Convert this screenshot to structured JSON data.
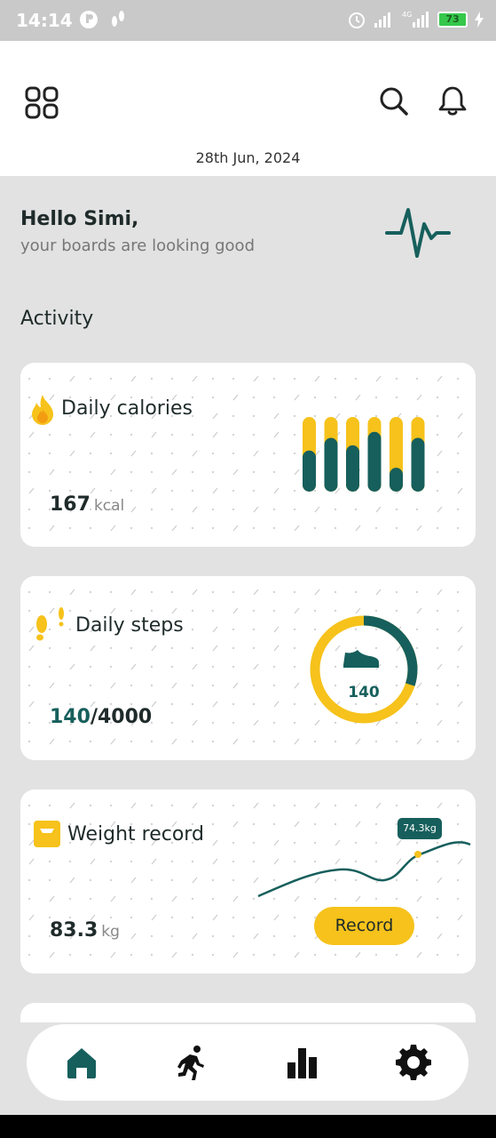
{
  "status_bar": {
    "time": "14:14",
    "battery": "73",
    "network": "4G"
  },
  "header": {
    "date": "28th Jun, 2024",
    "icons": [
      "grid-menu-icon",
      "search-icon",
      "bell-icon"
    ]
  },
  "greeting": {
    "hello": "Hello Simi,",
    "subtitle": "your boards are looking good"
  },
  "section_title": "Activity",
  "cards": {
    "calories": {
      "title": "Daily calories",
      "value": "167",
      "unit": "kcal",
      "bars": [
        {
          "total": 1,
          "filled": 0.55
        },
        {
          "total": 1,
          "filled": 0.72
        },
        {
          "total": 1,
          "filled": 0.62
        },
        {
          "total": 1,
          "filled": 0.8
        },
        {
          "total": 1,
          "filled": 0.32
        },
        {
          "total": 1,
          "filled": 0.72
        }
      ]
    },
    "steps": {
      "title": "Daily steps",
      "current": "140",
      "separator": "/",
      "goal": "4000",
      "ring_label": "140",
      "ring_progress": 0.3
    },
    "weight": {
      "title": "Weight record",
      "value": "83.3",
      "unit": "kg",
      "badge": "74.3kg",
      "button": "Record"
    }
  },
  "colors": {
    "teal": "#165f5c",
    "yellow": "#f6c21b",
    "background": "#e2e2e2"
  },
  "bottom_nav": [
    "home-icon",
    "run-icon",
    "stats-icon",
    "settings-icon"
  ]
}
